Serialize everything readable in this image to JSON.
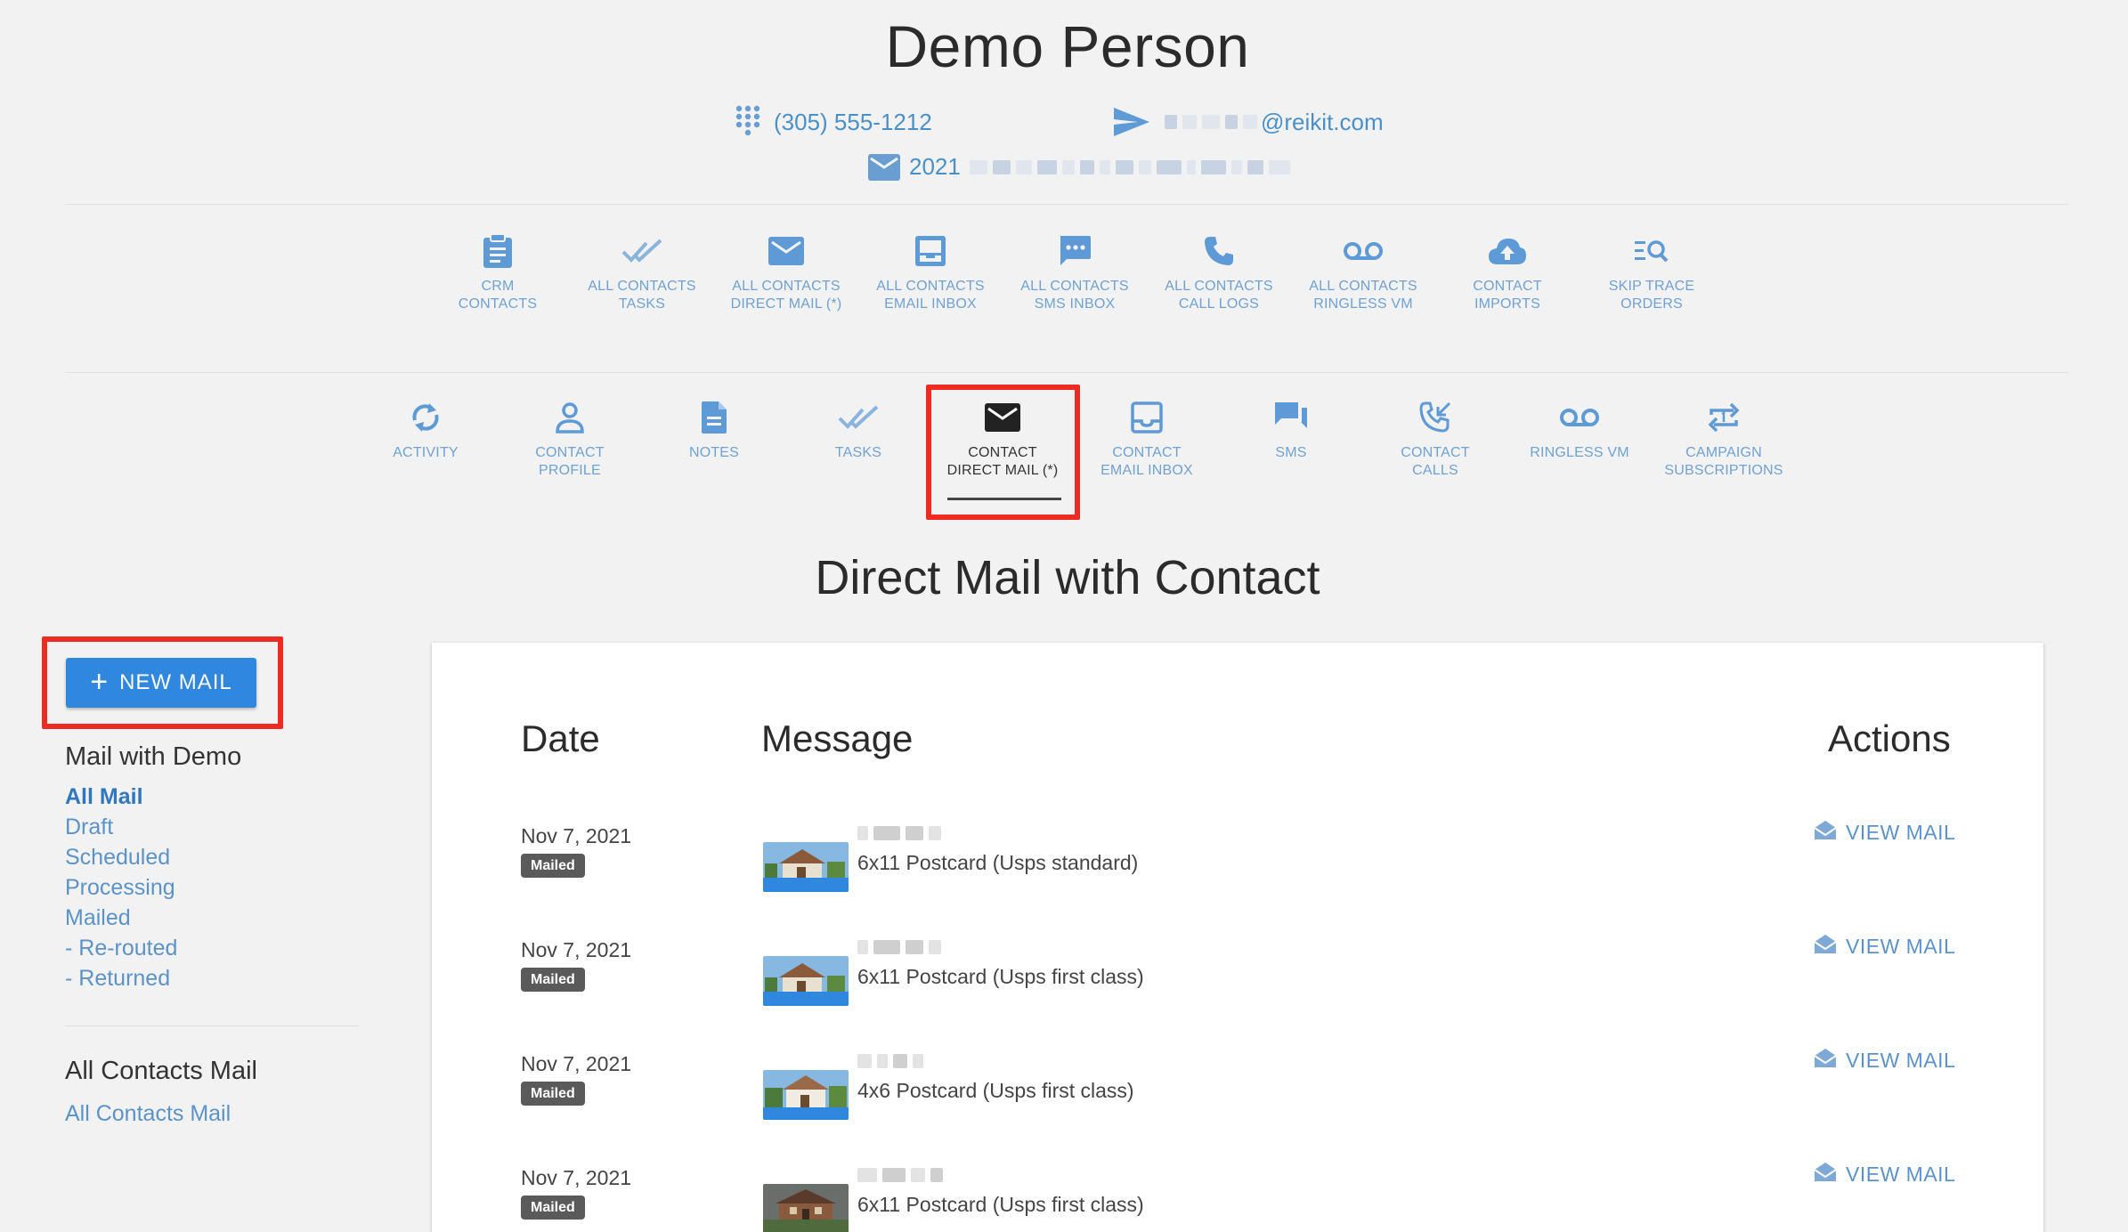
{
  "header": {
    "name": "Demo Person",
    "phone": "(305) 555-1212",
    "email_domain": "@reikit.com",
    "address_prefix": "2021"
  },
  "nav_top": [
    {
      "label": "CRM\nCONTACTS",
      "icon": "clipboard-icon"
    },
    {
      "label": "ALL CONTACTS\nTASKS",
      "icon": "double-check-icon"
    },
    {
      "label": "ALL CONTACTS\nDIRECT MAIL (*)",
      "icon": "envelope-icon"
    },
    {
      "label": "ALL CONTACTS\nEMAIL INBOX",
      "icon": "inbox-icon"
    },
    {
      "label": "ALL CONTACTS\nSMS INBOX",
      "icon": "chat-bubble-icon"
    },
    {
      "label": "ALL CONTACTS\nCALL LOGS",
      "icon": "phone-icon"
    },
    {
      "label": "ALL CONTACTS\nRINGLESS VM",
      "icon": "voicemail-icon"
    },
    {
      "label": "CONTACT\nIMPORTS",
      "icon": "cloud-upload-icon"
    },
    {
      "label": "SKIP TRACE\nORDERS",
      "icon": "list-search-icon"
    }
  ],
  "nav_contact": [
    {
      "label": "ACTIVITY",
      "icon": "refresh-icon"
    },
    {
      "label": "CONTACT\nPROFILE",
      "icon": "person-icon"
    },
    {
      "label": "NOTES",
      "icon": "document-icon"
    },
    {
      "label": "TASKS",
      "icon": "double-check-icon"
    },
    {
      "label": "CONTACT\nDIRECT MAIL (*)",
      "icon": "envelope-icon",
      "active": true
    },
    {
      "label": "CONTACT\nEMAIL INBOX",
      "icon": "inbox-icon"
    },
    {
      "label": "SMS",
      "icon": "chat-icon"
    },
    {
      "label": "CONTACT\nCALLS",
      "icon": "phone-incoming-icon"
    },
    {
      "label": "RINGLESS VM",
      "icon": "voicemail-icon"
    },
    {
      "label": "CAMPAIGN\nSUBSCRIPTIONS",
      "icon": "repeat-icon"
    }
  ],
  "section_title": "Direct Mail with Contact",
  "sidebar": {
    "new_mail_label": "NEW MAIL",
    "heading_contact": "Mail with Demo",
    "filters": [
      "All Mail",
      "Draft",
      "Scheduled",
      "Processing",
      "Mailed",
      "- Re-routed",
      "- Returned"
    ],
    "heading_all": "All Contacts Mail",
    "all_link": "All Contacts Mail"
  },
  "table": {
    "headers": {
      "date": "Date",
      "message": "Message",
      "actions": "Actions"
    },
    "rows": [
      {
        "date": "Nov 7, 2021",
        "status": "Mailed",
        "message": "6x11 Postcard (Usps standard)",
        "action": "VIEW MAIL"
      },
      {
        "date": "Nov 7, 2021",
        "status": "Mailed",
        "message": "6x11 Postcard (Usps first class)",
        "action": "VIEW MAIL"
      },
      {
        "date": "Nov 7, 2021",
        "status": "Mailed",
        "message": "4x6 Postcard (Usps first class)",
        "action": "VIEW MAIL"
      },
      {
        "date": "Nov 7, 2021",
        "status": "Mailed",
        "message": "6x11 Postcard (Usps first class)",
        "action": "VIEW MAIL"
      }
    ]
  },
  "colors": {
    "accent": "#2f87de",
    "link": "#5b93c9",
    "icon": "#5d9ad6",
    "highlight": "#ee2b22",
    "badge": "#5a5a5a"
  }
}
